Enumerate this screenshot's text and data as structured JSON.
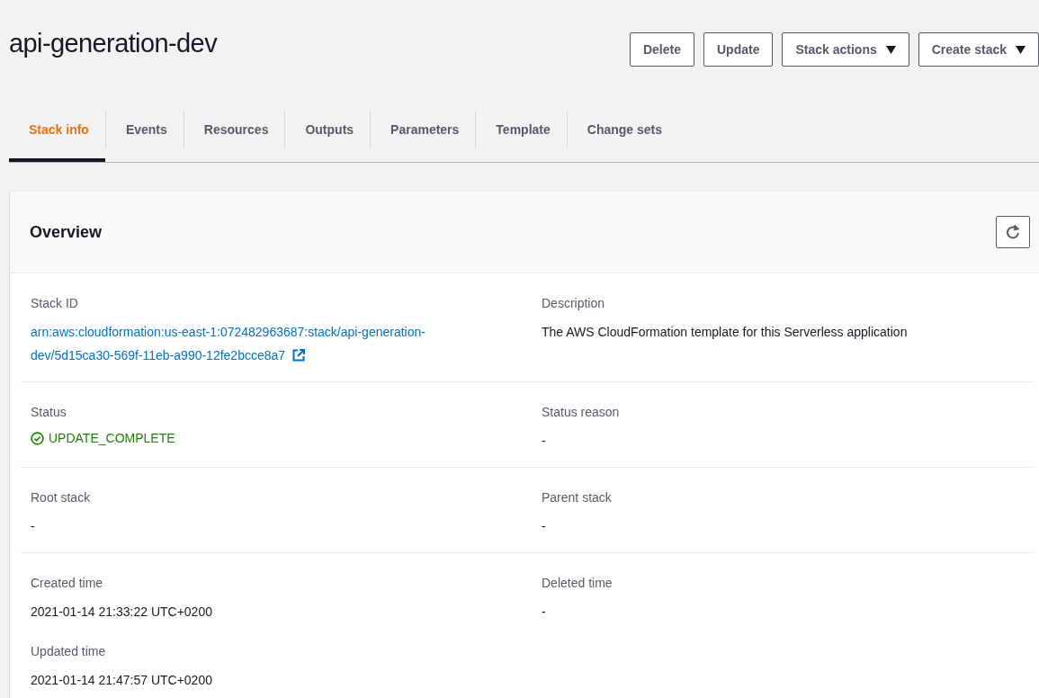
{
  "page": {
    "title": "api-generation-dev"
  },
  "actions": [
    {
      "label": "Delete",
      "dropdown": false
    },
    {
      "label": "Update",
      "dropdown": false
    },
    {
      "label": "Stack actions",
      "dropdown": true
    },
    {
      "label": "Create stack",
      "dropdown": true
    }
  ],
  "tabs": [
    {
      "label": "Stack info",
      "selected": true
    },
    {
      "label": "Events",
      "selected": false
    },
    {
      "label": "Resources",
      "selected": false
    },
    {
      "label": "Outputs",
      "selected": false
    },
    {
      "label": "Parameters",
      "selected": false
    },
    {
      "label": "Template",
      "selected": false
    },
    {
      "label": "Change sets",
      "selected": false
    }
  ],
  "overview": {
    "title": "Overview",
    "rows": [
      {
        "left": [
          {
            "label": "Stack ID",
            "value": "arn:aws:cloudformation:us-east-1:072482963687:stack/api-generation-dev/5d15ca30-569f-11eb-a990-12fe2bcce8a7",
            "kind": "link"
          }
        ],
        "right": [
          {
            "label": "Description",
            "value": "The AWS CloudFormation template for this Serverless application",
            "kind": "text"
          }
        ]
      },
      {
        "left": [
          {
            "label": "Status",
            "value": "UPDATE_COMPLETE",
            "kind": "status"
          }
        ],
        "right": [
          {
            "label": "Status reason",
            "value": "-",
            "kind": "text"
          }
        ]
      },
      {
        "left": [
          {
            "label": "Root stack",
            "value": "-",
            "kind": "text"
          }
        ],
        "right": [
          {
            "label": "Parent stack",
            "value": "-",
            "kind": "text"
          }
        ]
      },
      {
        "left": [
          {
            "label": "Created time",
            "value": "2021-01-14 21:33:22 UTC+0200",
            "kind": "text"
          },
          {
            "label": "Updated time",
            "value": "2021-01-14 21:47:57 UTC+0200",
            "kind": "text"
          }
        ],
        "right": [
          {
            "label": "Deleted time",
            "value": "-",
            "kind": "text"
          }
        ]
      }
    ]
  }
}
